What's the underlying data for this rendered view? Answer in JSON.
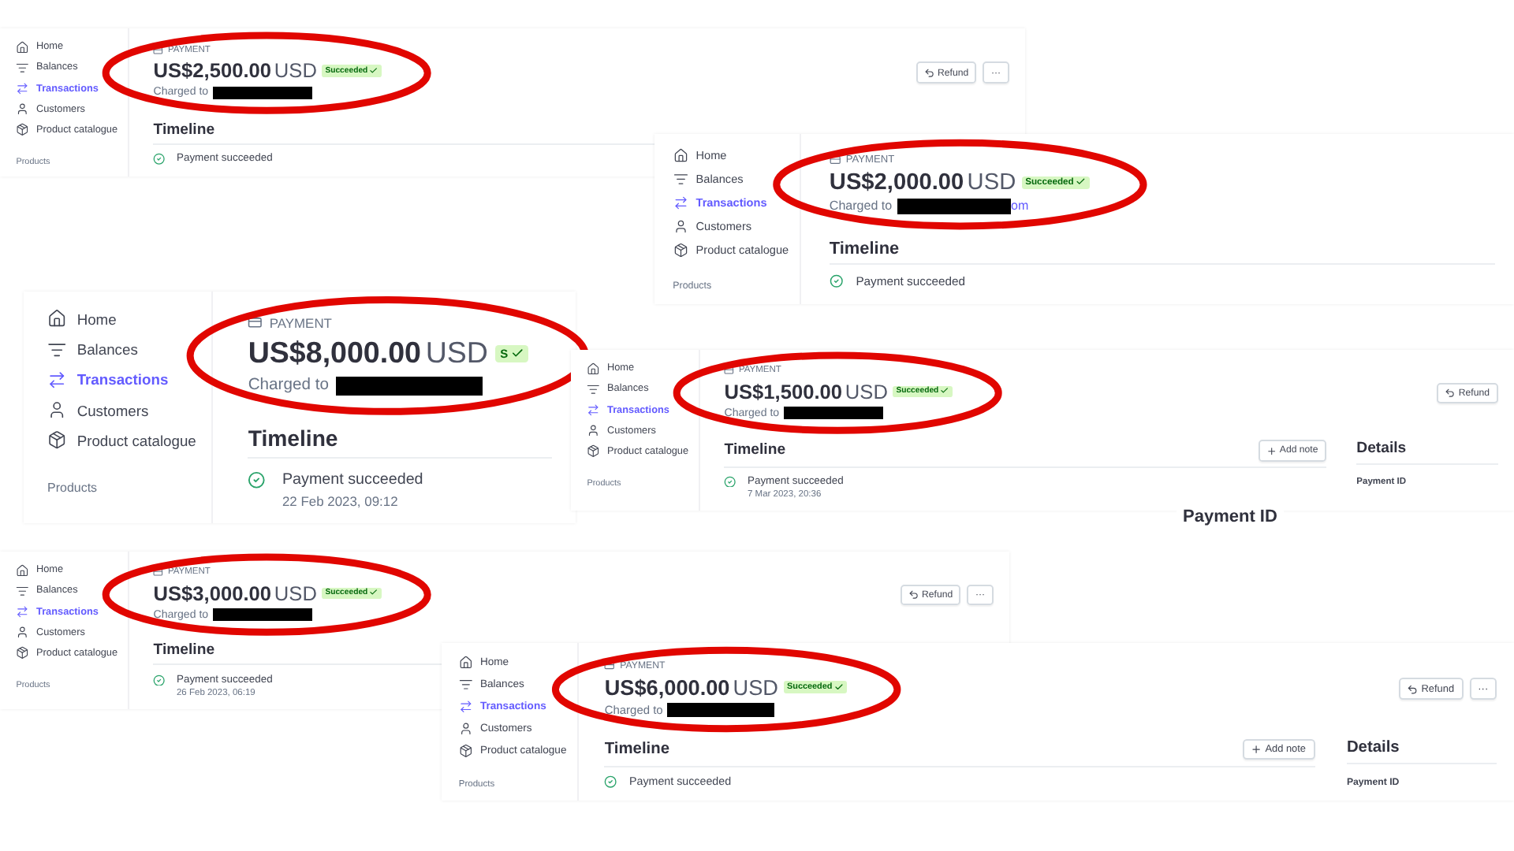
{
  "panels": [
    {
      "nav": [
        {
          "label": "Home",
          "selected": false
        },
        {
          "label": "Balances",
          "selected": false
        },
        {
          "label": "Transactions",
          "selected": true
        },
        {
          "label": "Customers",
          "selected": false
        },
        {
          "label": "Product catalogue",
          "selected": false
        }
      ],
      "section": "Products",
      "kind_label": "PAYMENT",
      "amount": "US$2,500.00",
      "currency": "USD",
      "status": "Succeeded",
      "charged_to": "Charged to",
      "timeline": "Timeline",
      "events": [
        {
          "text": "Payment succeeded"
        }
      ],
      "actions": [
        {
          "kind": "refund",
          "label": "Refund"
        },
        {
          "kind": "more",
          "label": "···"
        }
      ]
    },
    {
      "nav": [
        {
          "label": "Home",
          "selected": false
        },
        {
          "label": "Balances",
          "selected": false
        },
        {
          "label": "Transactions",
          "selected": true
        },
        {
          "label": "Customers",
          "selected": false
        },
        {
          "label": "Product catalogue",
          "selected": false
        }
      ],
      "section": "Products",
      "kind_label": "PAYMENT",
      "amount": "US$2,000.00",
      "currency": "USD",
      "status": "Succeeded",
      "charged_to": "Charged to",
      "charged_suffix": "om",
      "timeline": "Timeline",
      "events": [
        {
          "text": "Payment succeeded"
        }
      ]
    },
    {
      "nav": [
        {
          "label": "Home",
          "selected": false
        },
        {
          "label": "Balances",
          "selected": false
        },
        {
          "label": "Transactions",
          "selected": true
        },
        {
          "label": "Customers",
          "selected": false
        },
        {
          "label": "Product catalogue",
          "selected": false
        }
      ],
      "section": "Products",
      "kind_label": "PAYMENT",
      "amount": "US$8,000.00",
      "currency": "USD",
      "status": "S",
      "charged_to": "Charged to",
      "timeline": "Timeline",
      "events": [
        {
          "text": "Payment succeeded",
          "date": "22 Feb 2023, 09:12"
        }
      ]
    },
    {
      "nav": [
        {
          "label": "Home",
          "selected": false
        },
        {
          "label": "Balances",
          "selected": false
        },
        {
          "label": "Transactions",
          "selected": true
        },
        {
          "label": "Customers",
          "selected": false
        },
        {
          "label": "Product catalogue",
          "selected": false
        }
      ],
      "section": "Products",
      "kind_label": "PAYMENT",
      "amount": "US$1,500.00",
      "currency": "USD",
      "status": "Succeeded",
      "charged_to": "Charged to",
      "timeline": "Timeline",
      "events": [
        {
          "text": "Payment succeeded",
          "date": "7 Mar 2023, 20:36"
        }
      ],
      "actions": [
        {
          "kind": "refund",
          "label": "Refund"
        }
      ],
      "add_note": "Add note",
      "details": {
        "title": "Details",
        "field": "Payment ID"
      }
    },
    {
      "nav": [
        {
          "label": "Home",
          "selected": false
        },
        {
          "label": "Balances",
          "selected": false
        },
        {
          "label": "Transactions",
          "selected": true
        },
        {
          "label": "Customers",
          "selected": false
        },
        {
          "label": "Product catalogue",
          "selected": false
        }
      ],
      "section": "Products",
      "kind_label": "PAYMENT",
      "amount": "US$3,000.00",
      "currency": "USD",
      "status": "Succeeded",
      "charged_to": "Charged to",
      "timeline": "Timeline",
      "events": [
        {
          "text": "Payment succeeded",
          "date": "26 Feb 2023, 06:19"
        }
      ],
      "actions": [
        {
          "kind": "refund",
          "label": "Refund"
        },
        {
          "kind": "more",
          "label": "···"
        }
      ]
    },
    {
      "nav": [
        {
          "label": "Home",
          "selected": false
        },
        {
          "label": "Balances",
          "selected": false
        },
        {
          "label": "Transactions",
          "selected": true
        },
        {
          "label": "Customers",
          "selected": false
        },
        {
          "label": "Product catalogue",
          "selected": false
        }
      ],
      "section": "Products",
      "kind_label": "PAYMENT",
      "amount": "US$6,000.00",
      "currency": "USD",
      "status": "Succeeded",
      "charged_to": "Charged to",
      "timeline": "Timeline",
      "events": [
        {
          "text": "Payment succeeded"
        }
      ],
      "actions": [
        {
          "kind": "refund",
          "label": "Refund"
        },
        {
          "kind": "more",
          "label": "···"
        }
      ],
      "add_note": "Add note",
      "details": {
        "title": "Details",
        "field": "Payment ID"
      }
    }
  ],
  "fragment_heading": "Payment ID"
}
